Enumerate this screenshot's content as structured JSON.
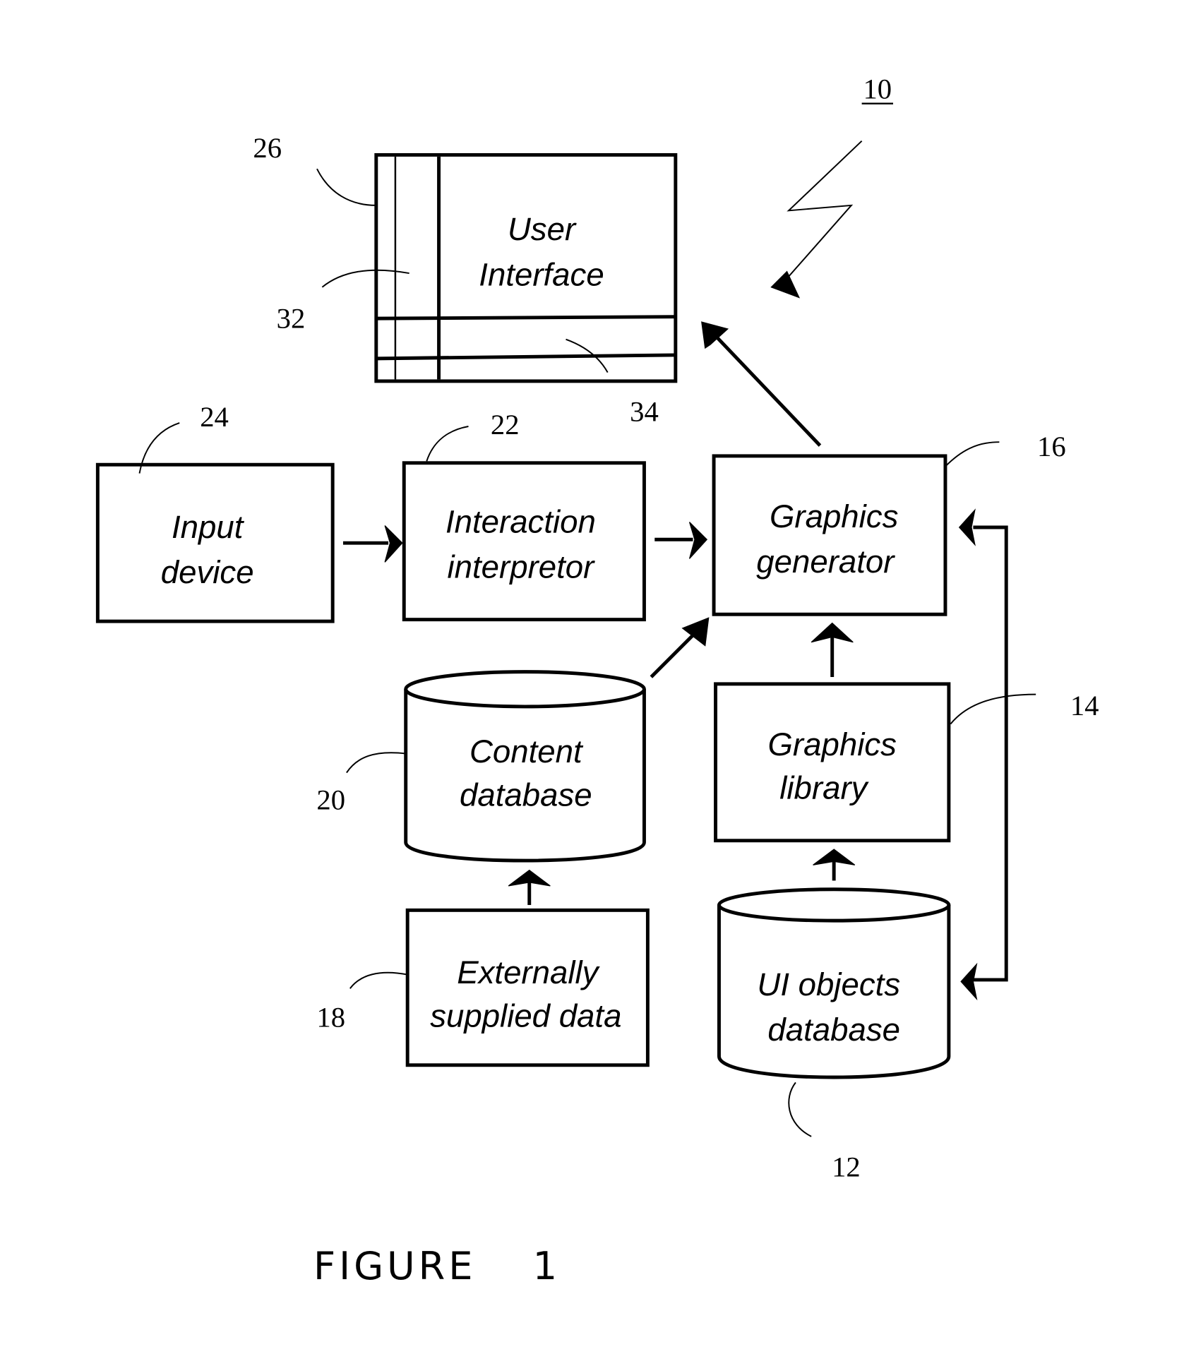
{
  "figure": {
    "caption": "FIGURE 1",
    "caption_word": "FIGURE",
    "caption_number": "1",
    "system_ref": "10"
  },
  "blocks": {
    "user_interface": {
      "ref": "26",
      "line1": "User",
      "line2": "Interface",
      "sub_ref_a": "32",
      "sub_ref_b": "34"
    },
    "input_device": {
      "ref": "24",
      "line1": "Input",
      "line2": "device"
    },
    "interaction_interpreter": {
      "ref": "22",
      "line1": "Interaction",
      "line2": "interpretor"
    },
    "graphics_generator": {
      "ref": "16",
      "line1": "Graphics",
      "line2": "generator"
    },
    "content_database": {
      "ref": "20",
      "line1": "Content",
      "line2": "database"
    },
    "graphics_library": {
      "ref": "14",
      "line1": "Graphics",
      "line2": "library"
    },
    "externally_supplied_data": {
      "ref": "18",
      "line1": "Externally",
      "line2": "supplied data"
    },
    "ui_objects_database": {
      "ref": "12",
      "line1": "UI objects",
      "line2": "database"
    }
  },
  "connections": [
    {
      "from": "input_device",
      "to": "interaction_interpreter"
    },
    {
      "from": "interaction_interpreter",
      "to": "graphics_generator"
    },
    {
      "from": "content_database",
      "to": "graphics_generator"
    },
    {
      "from": "graphics_library",
      "to": "graphics_generator"
    },
    {
      "from": "graphics_generator",
      "to": "user_interface"
    },
    {
      "from": "externally_supplied_data",
      "to": "content_database"
    },
    {
      "from": "ui_objects_database",
      "to": "graphics_library"
    },
    {
      "from": "graphics_generator",
      "to": "ui_objects_database",
      "bidirectional": true
    }
  ]
}
